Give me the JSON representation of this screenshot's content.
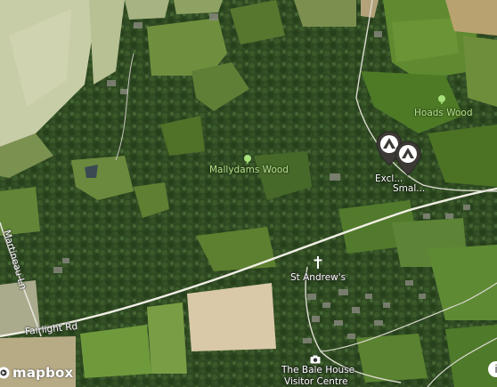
{
  "map": {
    "labels": {
      "mallydams_wood": "Mallydams Wood",
      "hoads_wood": "Hoads Wood",
      "st_andrews": "St Andrew's",
      "martineau_ln": "Martineau Ln",
      "fairlight_rd": "Fairlight Rd",
      "bale_house_line1": "The Bale House",
      "bale_house_line2": "Visitor Centre"
    },
    "markers": [
      {
        "label": "Excl...",
        "icon": "campsite-marker-icon"
      },
      {
        "label": "Smal...",
        "icon": "campsite-marker-icon"
      }
    ],
    "icons": {
      "park": "tree-icon",
      "church": "church-cross-icon",
      "museum": "camera-icon"
    },
    "branding": {
      "logo_text": "mapbox",
      "attribution_symbol": "i"
    },
    "colors": {
      "woodland": "#2f4a22",
      "field_light": "#c9cfa6",
      "road": "#f3f1ea",
      "park_label": "#b6e08a",
      "marker": "#3d3a36"
    }
  }
}
